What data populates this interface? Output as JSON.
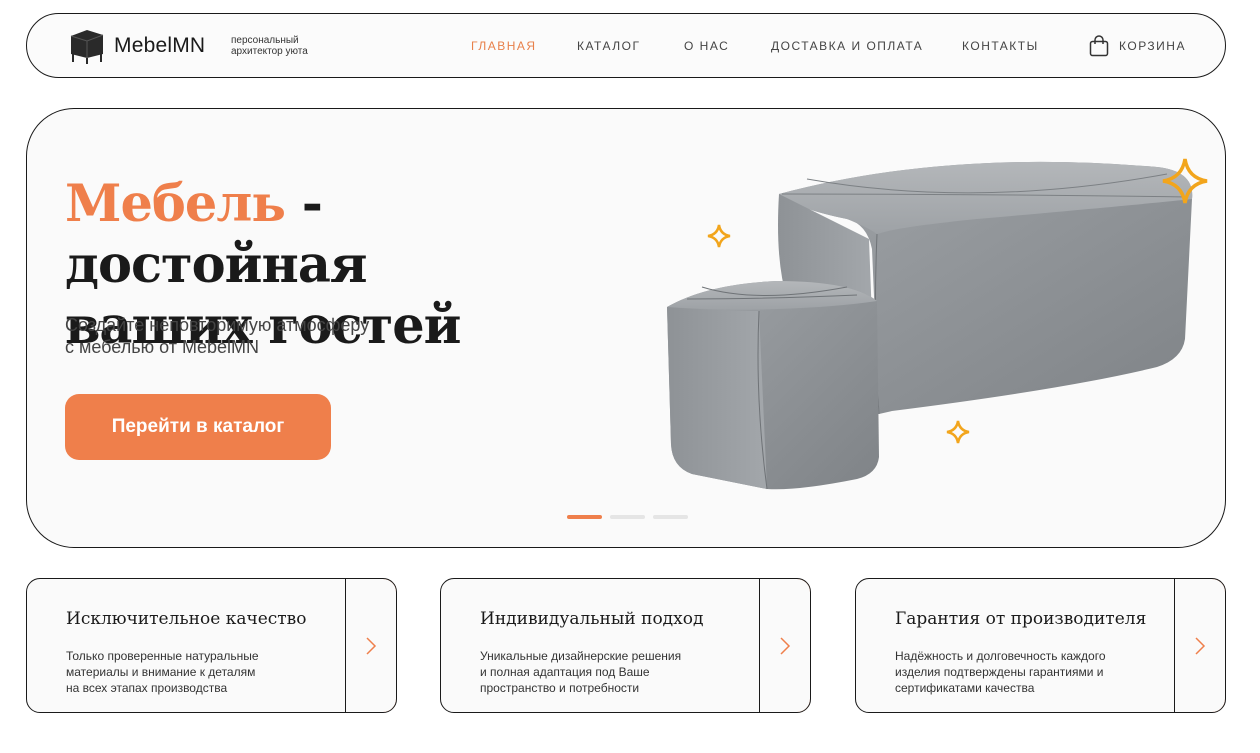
{
  "header": {
    "brand": "MebelMN",
    "tagline_line1": "персональный",
    "tagline_line2": "архитектор уюта",
    "nav": [
      "ГЛАВНАЯ",
      "КАТАЛОГ",
      "О НАС",
      "ДОСТАВКА И ОПЛАТА",
      "КОНТАКТЫ"
    ],
    "cart_label": "КОРЗИНА"
  },
  "hero": {
    "title_accent": "Мебель",
    "title_rest_line1": " - достойная",
    "title_line2": "ваших гостей",
    "subtitle_line1": "Создайте неповторимую атмосферу",
    "subtitle_line2": "с мебелью от MebelMN",
    "cta_label": "Перейти в каталог",
    "slides_total": 3,
    "active_slide": 1
  },
  "features": [
    {
      "title": "Исключительное качество",
      "text_lines": [
        "Только проверенные натуральные",
        "материалы и внимание к деталям",
        "на всех этапах производства"
      ]
    },
    {
      "title": "Индивидуальный подход",
      "text_lines": [
        "Уникальные дизайнерские решения",
        "и полная адаптация под Ваше",
        "пространство и потребности"
      ]
    },
    {
      "title": "Гарантия от производителя",
      "text_lines": [
        "Надёжность и долговечность каждого",
        "изделия подтверждены гарантиями и",
        "сертификатами качества"
      ]
    }
  ],
  "icons": {
    "logo": "armchair-logo-icon",
    "cart": "shopping-bag-icon",
    "card_arrow": "chevron-right-icon",
    "sparkle": "sparkle-icon"
  },
  "colors": {
    "accent": "#ef7f4b",
    "sparkle": "#f2a51c",
    "text": "#1a1a1a",
    "background": "#fafafa"
  }
}
